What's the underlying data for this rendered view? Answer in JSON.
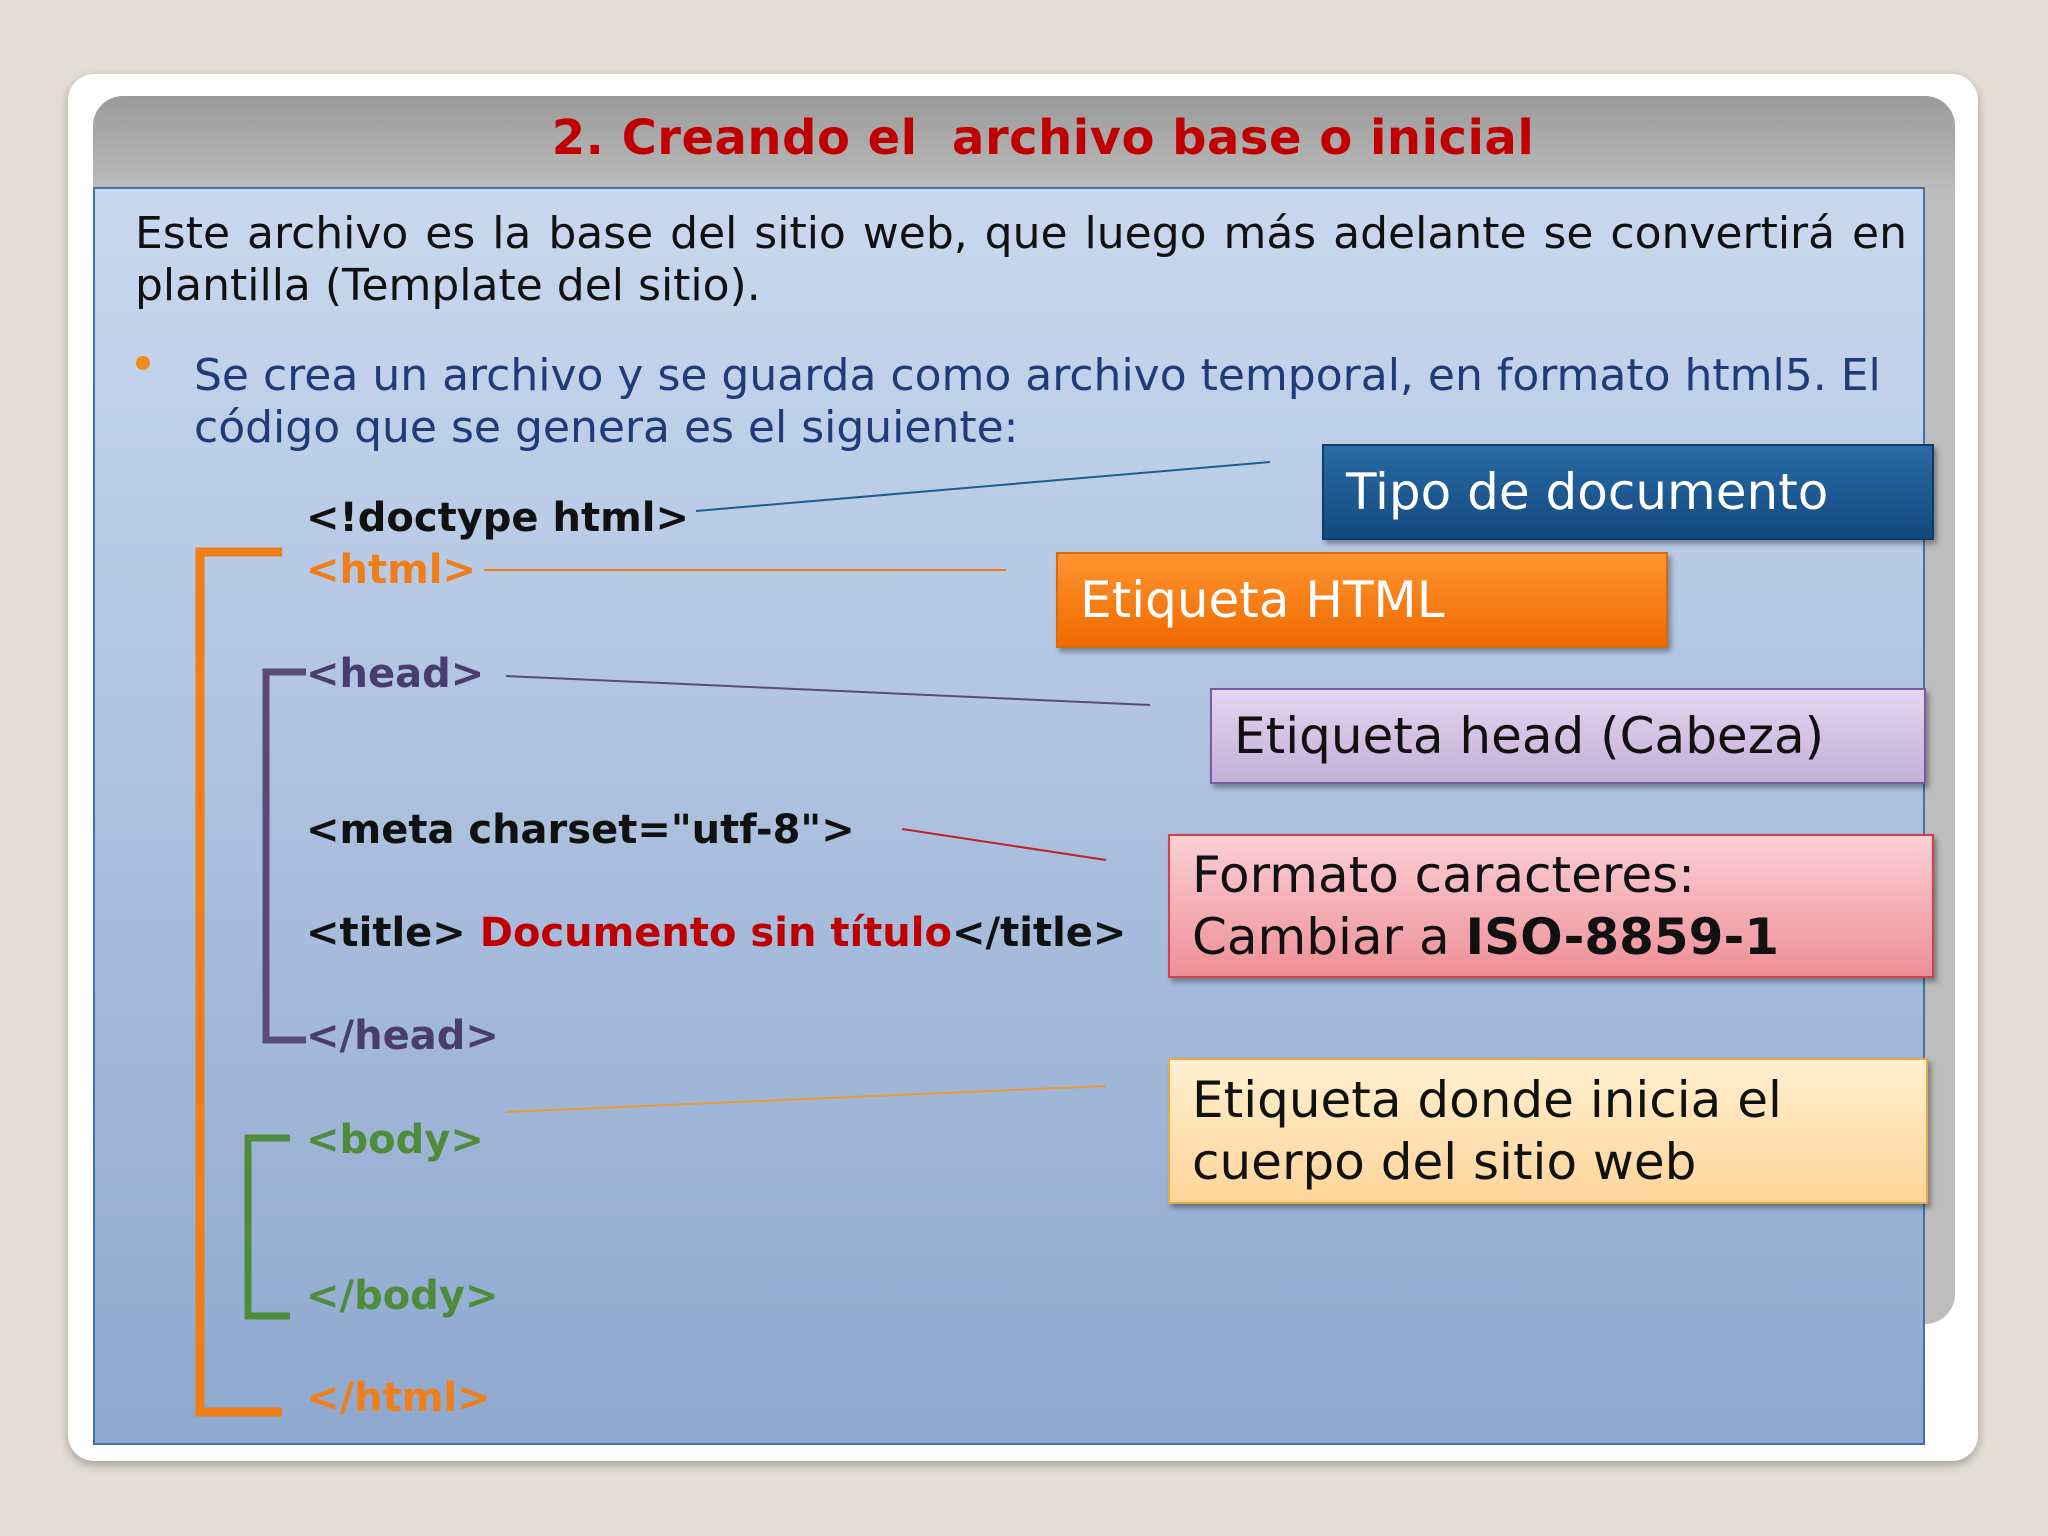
{
  "slide": {
    "title": "2. Creando el  archivo base o inicial",
    "intro": "Este archivo es la base del sitio web, que luego más adelante se convertirá en plantilla (Template del sitio).",
    "bullet": "Se crea un archivo y se guarda como archivo temporal, en formato html5. El código que se genera es el siguiente:"
  },
  "code": {
    "doctype": "<!doctype html>",
    "html_open": "<html>",
    "head_open": "<head>",
    "meta": "<meta charset=\"utf-8\">",
    "title_open": "<title> ",
    "title_text": "Documento sin título",
    "title_close": "</title>",
    "head_close": "</head>",
    "body_open": "<body>",
    "body_close": "</body>",
    "html_close": "</html>"
  },
  "callouts": {
    "doctype": "Tipo de documento",
    "html": "Etiqueta HTML",
    "head": "Etiqueta head (Cabeza)",
    "meta_line1": "Formato caracteres:",
    "meta_line2_prefix": "Cambiar a ",
    "meta_line2_bold": "ISO-8859-1",
    "body_line1": "Etiqueta donde inicia el",
    "body_line2": "cuerpo del sitio web"
  },
  "colors": {
    "title": "#c00000",
    "html_tag": "#ef7d18",
    "head_tag": "#4a3d6e",
    "body_tag": "#4e8c3c",
    "title_text": "#c00000"
  }
}
